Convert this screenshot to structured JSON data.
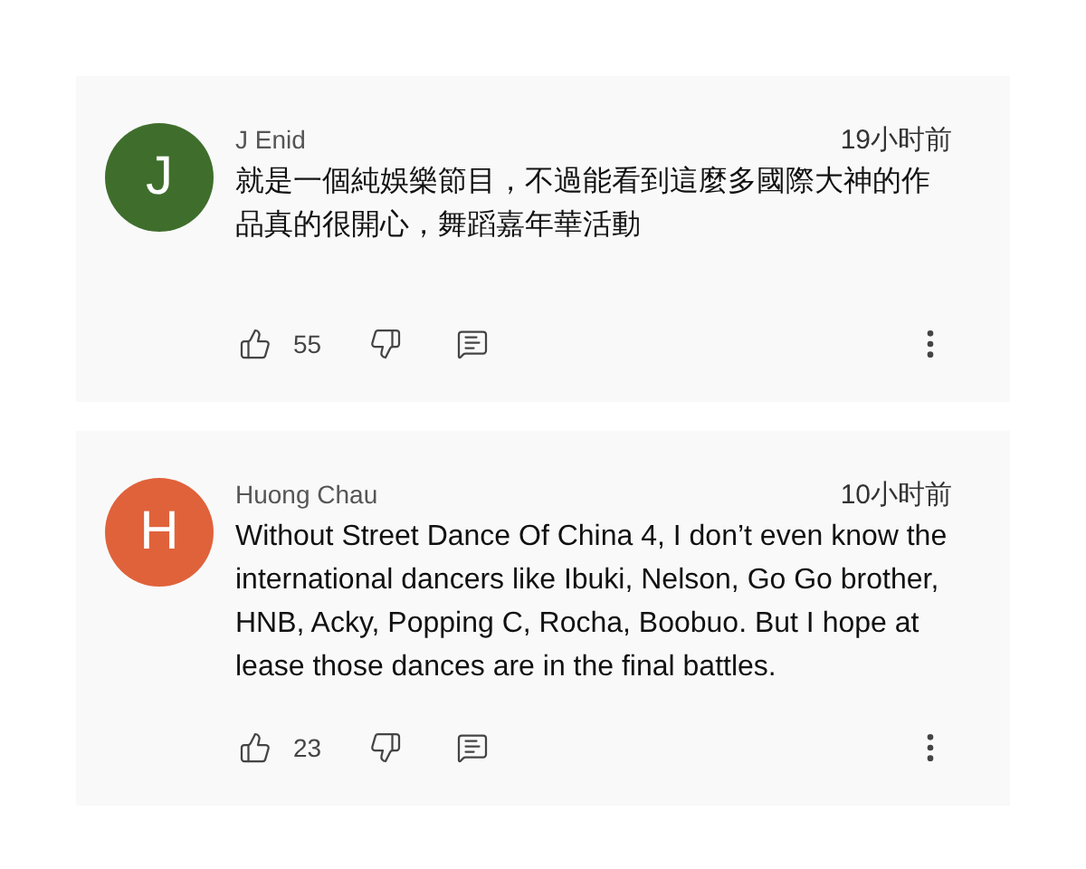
{
  "comments": [
    {
      "avatar": {
        "letter": "J",
        "color": "#3f6e2c"
      },
      "author": "J Enid",
      "time": "19小时前",
      "text": "就是一個純娛樂節目，不過能看到這麼多國際大神的作品真的很開心，舞蹈嘉年華活動",
      "likes": "55"
    },
    {
      "avatar": {
        "letter": "H",
        "color": "#e0623b"
      },
      "author": "Huong Chau",
      "time": "10小时前",
      "text": "Without Street Dance Of China 4, I don’t even know the international dancers like Ibuki, Nelson, Go Go brother, HNB, Acky, Popping C, Rocha, Boobuo. But I hope at lease those dances are in the final battles.",
      "likes": "23"
    }
  ]
}
